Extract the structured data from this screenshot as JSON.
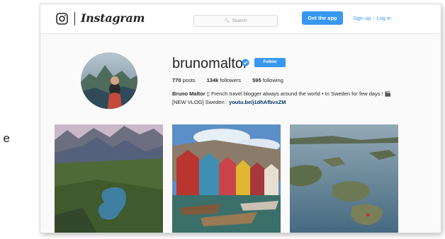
{
  "page": {
    "stray_text": "e"
  },
  "header": {
    "logo_text": "Instagram",
    "search_placeholder": "Search",
    "get_app_label": "Get the app",
    "signup_label": "Sign up",
    "separator": "|",
    "login_label": "Log in",
    "icons": {
      "logo": "camera-icon",
      "search": "search-icon"
    }
  },
  "profile": {
    "username": "brunomaltor",
    "follow_label": "Follow",
    "stats": {
      "posts_count": "770",
      "posts_label": "posts",
      "followers_count": "134k",
      "followers_label": "followers",
      "following_count": "595",
      "following_label": "following"
    },
    "bio": {
      "name": "Bruno Maltor",
      "text": " ▯ French travel blogger always around the world ▪ In Sweden for few days ! 🎬 [NEW VLOG] Sweden : ",
      "link": "youtu.be/j1dhAfbvxZM"
    },
    "icons": {
      "verified": "verified-badge-icon"
    }
  },
  "posts": [
    {
      "subject": "mountain-lake-photo"
    },
    {
      "subject": "colorful-boathouses-photo"
    },
    {
      "subject": "archipelago-aerial-photo"
    }
  ],
  "colors": {
    "accent": "#3897f0",
    "text": "#262626",
    "link": "#003569",
    "background": "#fafafa"
  }
}
